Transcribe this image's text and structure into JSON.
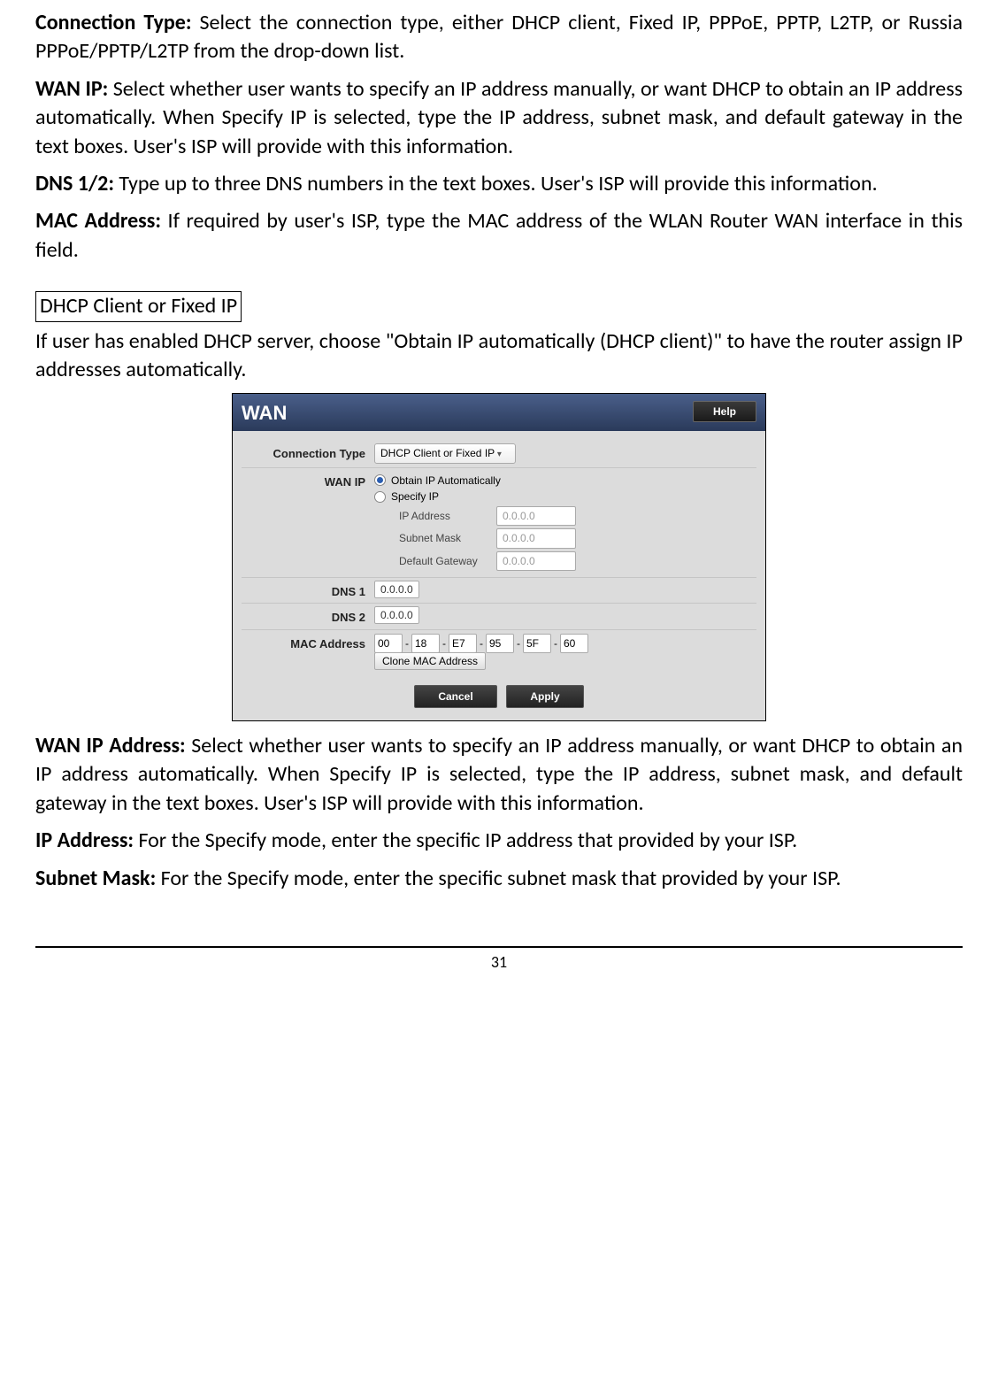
{
  "paragraphs": {
    "p1_label": "Connection Type:",
    "p1_text": " Select the connection type, either DHCP client, Fixed IP, PPPoE, PPTP, L2TP, or Russia PPPoE/PPTP/L2TP from the drop-down list.",
    "p2_label": "WAN IP:",
    "p2_text": " Select whether user wants to specify an IP address manually, or want DHCP to obtain an IP address automatically. When Specify IP is selected, type the IP address, subnet mask, and default gateway in the text boxes. User's ISP will provide with this information.",
    "p3_label": "DNS 1/2:",
    "p3_text": " Type up to three DNS numbers in the text boxes. User's ISP will provide this information.",
    "p4_label": "MAC Address:",
    "p4_text": " If required by user's ISP, type the MAC address of the WLAN Router WAN interface in this field.",
    "box_title": "DHCP Client or Fixed IP",
    "p5_text": "If user has enabled DHCP server, choose \"Obtain IP automatically (DHCP client)\" to have the router assign IP addresses automatically.",
    "p6_label": "WAN IP Address:",
    "p6_text": " Select whether user wants to specify an IP address manually, or want DHCP to obtain an IP address automatically. When Specify IP is selected, type the IP address, subnet mask, and default gateway in the text boxes. User's ISP will provide with this information.",
    "p7_label": "IP Address:",
    "p7_text": " For the Specify mode, enter the specific IP address that provided by your ISP.",
    "p8_label": "Subnet Mask:",
    "p8_text": " For the Specify mode, enter the specific subnet mask that provided by your ISP."
  },
  "wan_panel": {
    "title": "WAN",
    "help": "Help",
    "rows": {
      "connection_type_label": "Connection Type",
      "connection_type_value": "DHCP Client or Fixed IP",
      "wan_ip_label": "WAN IP",
      "radio_obtain": "Obtain IP Automatically",
      "radio_specify": "Specify IP",
      "ip_address_label": "IP Address",
      "ip_address_value": "0.0.0.0",
      "subnet_label": "Subnet Mask",
      "subnet_value": "0.0.0.0",
      "gateway_label": "Default Gateway",
      "gateway_value": "0.0.0.0",
      "dns1_label": "DNS 1",
      "dns1_value": "0.0.0.0",
      "dns2_label": "DNS 2",
      "dns2_value": "0.0.0.0",
      "mac_label": "MAC Address",
      "mac": [
        "00",
        "18",
        "E7",
        "95",
        "5F",
        "60"
      ],
      "mac_sep": "-",
      "clone": "Clone MAC Address",
      "cancel": "Cancel",
      "apply": "Apply"
    }
  },
  "page_number": "31"
}
